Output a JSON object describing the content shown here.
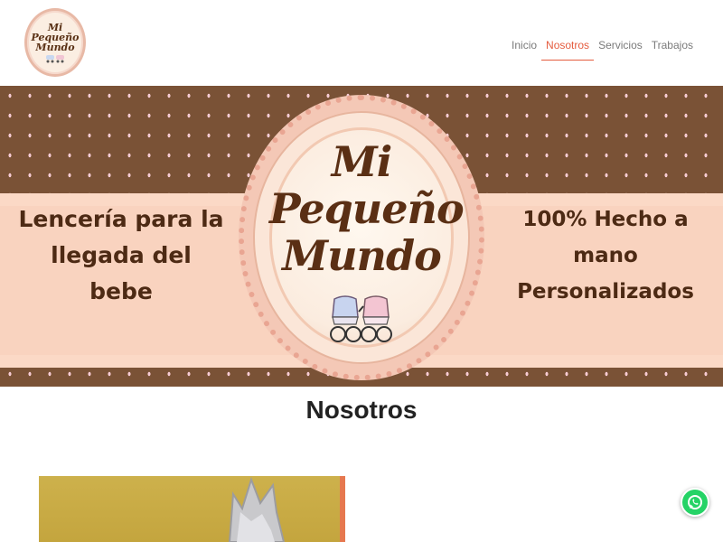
{
  "brand": {
    "logo_text": "Mi\nPequeño\nMundo"
  },
  "nav": {
    "items": [
      {
        "label": "Inicio",
        "active": false
      },
      {
        "label": "Nosotros",
        "active": true
      },
      {
        "label": "Servicios",
        "active": false
      },
      {
        "label": "Trabajos",
        "active": false
      }
    ],
    "active_color": "#e55c3f"
  },
  "banner": {
    "title": "Mi\nPequeño\nMundo",
    "left_line1": "Lencería para la",
    "left_line2": "llegada del bebe",
    "right_line1": "100% Hecho a mano",
    "right_line2": "Personalizados",
    "background_color": "#7a5236",
    "dot_color": "#f7cbd3",
    "stripe_color": "#f9d3bf"
  },
  "section": {
    "title": "Nosotros"
  },
  "floating": {
    "whatsapp_icon": "whatsapp-icon",
    "whatsapp_color": "#25d366"
  }
}
